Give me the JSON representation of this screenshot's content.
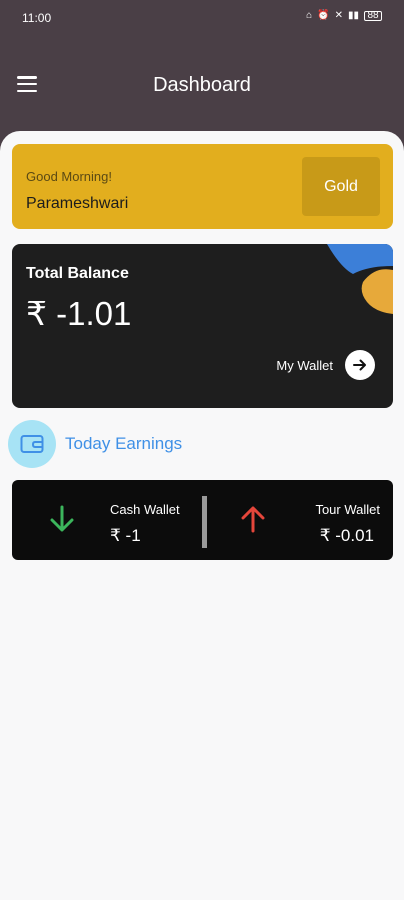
{
  "status_bar": {
    "time": "11:00",
    "icons": [
      "home-icon",
      "alarm-icon",
      "mute-icon",
      "signal-icon",
      "battery-icon"
    ],
    "battery": "88"
  },
  "app_bar": {
    "title": "Dashboard",
    "menu_icon": "hamburger-menu-icon"
  },
  "greeting_card": {
    "greeting": "Good Morning!",
    "name": "Parameshwari",
    "tier_label": "Gold",
    "background": "#e2ae1e"
  },
  "balance_card": {
    "label": "Total Balance",
    "amount": "₹ -1.01",
    "wallet_link_label": "My Wallet",
    "accent_colors": [
      "#3c7fd8",
      "#e7a93a"
    ]
  },
  "earnings": {
    "label": "Today Earnings",
    "icon": "wallet-icon"
  },
  "wallets": [
    {
      "name": "Cash Wallet",
      "value": "₹ -1",
      "icon": "arrow-down-icon",
      "icon_color": "#3cb55c"
    },
    {
      "name": "Tour Wallet",
      "value": "₹ -0.01",
      "icon": "arrow-up-icon",
      "icon_color": "#e5463b"
    }
  ]
}
